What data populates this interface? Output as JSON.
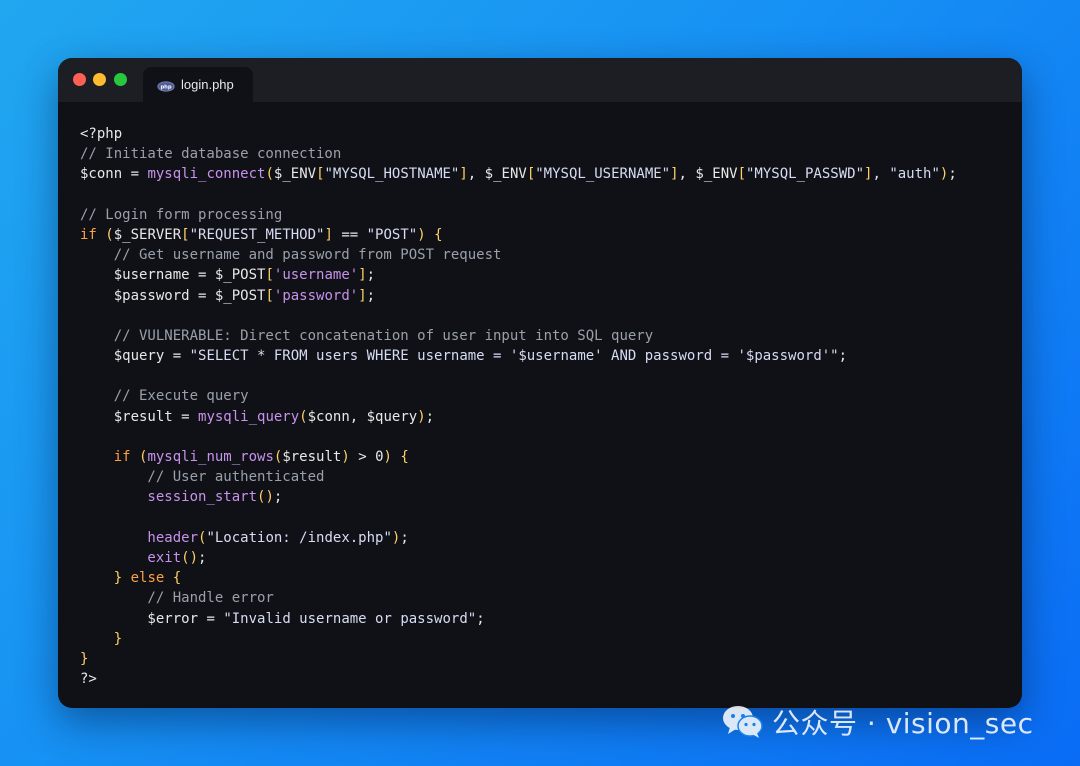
{
  "window": {
    "tab_label": "login.php",
    "tab_icon": "php-icon",
    "traffic_lights": {
      "close": "#fe5f57",
      "minimize": "#febc2e",
      "maximize": "#27c840"
    }
  },
  "colors": {
    "background_start": "#21a7f0",
    "background_end": "#0a6cf5",
    "editor_bg": "#0f1117",
    "keyword": "#ff9f43",
    "function": "#c792ea",
    "comment": "#9aa0aa",
    "bracket": "#ffd166"
  },
  "code_lines": [
    [
      {
        "t": "<?php",
        "c": "tag"
      }
    ],
    [
      {
        "t": "// Initiate database connection",
        "c": "cmt"
      }
    ],
    [
      {
        "t": "$conn",
        "c": "var"
      },
      {
        "t": " = ",
        "c": "pl"
      },
      {
        "t": "mysqli_connect",
        "c": "fn"
      },
      {
        "t": "(",
        "c": "br"
      },
      {
        "t": "$_ENV",
        "c": "var"
      },
      {
        "t": "[",
        "c": "br"
      },
      {
        "t": "\"MYSQL_HOSTNAME\"",
        "c": "str"
      },
      {
        "t": "]",
        "c": "br"
      },
      {
        "t": ", ",
        "c": "pl"
      },
      {
        "t": "$_ENV",
        "c": "var"
      },
      {
        "t": "[",
        "c": "br"
      },
      {
        "t": "\"MYSQL_USERNAME\"",
        "c": "str"
      },
      {
        "t": "]",
        "c": "br"
      },
      {
        "t": ", ",
        "c": "pl"
      },
      {
        "t": "$_ENV",
        "c": "var"
      },
      {
        "t": "[",
        "c": "br"
      },
      {
        "t": "\"MYSQL_PASSWD\"",
        "c": "str"
      },
      {
        "t": "]",
        "c": "br"
      },
      {
        "t": ", ",
        "c": "pl"
      },
      {
        "t": "\"auth\"",
        "c": "str"
      },
      {
        "t": ")",
        "c": "br"
      },
      {
        "t": ";",
        "c": "pl"
      }
    ],
    [],
    [
      {
        "t": "// Login form processing",
        "c": "cmt"
      }
    ],
    [
      {
        "t": "if",
        "c": "kw"
      },
      {
        "t": " ",
        "c": "pl"
      },
      {
        "t": "(",
        "c": "br"
      },
      {
        "t": "$_SERVER",
        "c": "var"
      },
      {
        "t": "[",
        "c": "br"
      },
      {
        "t": "\"REQUEST_METHOD\"",
        "c": "str"
      },
      {
        "t": "]",
        "c": "br"
      },
      {
        "t": " == ",
        "c": "pl"
      },
      {
        "t": "\"POST\"",
        "c": "str"
      },
      {
        "t": ")",
        "c": "br"
      },
      {
        "t": " ",
        "c": "pl"
      },
      {
        "t": "{",
        "c": "br"
      }
    ],
    [
      {
        "t": "    // Get username and password from POST request",
        "c": "cmt"
      }
    ],
    [
      {
        "t": "    $username",
        "c": "var"
      },
      {
        "t": " = ",
        "c": "pl"
      },
      {
        "t": "$_POST",
        "c": "var"
      },
      {
        "t": "[",
        "c": "br"
      },
      {
        "t": "'username'",
        "c": "fn"
      },
      {
        "t": "]",
        "c": "br"
      },
      {
        "t": ";",
        "c": "pl"
      }
    ],
    [
      {
        "t": "    $password",
        "c": "var"
      },
      {
        "t": " = ",
        "c": "pl"
      },
      {
        "t": "$_POST",
        "c": "var"
      },
      {
        "t": "[",
        "c": "br"
      },
      {
        "t": "'password'",
        "c": "fn"
      },
      {
        "t": "]",
        "c": "br"
      },
      {
        "t": ";",
        "c": "pl"
      }
    ],
    [],
    [
      {
        "t": "    // VULNERABLE: Direct concatenation of user input into SQL query",
        "c": "cmt"
      }
    ],
    [
      {
        "t": "    $query",
        "c": "var"
      },
      {
        "t": " = ",
        "c": "pl"
      },
      {
        "t": "\"SELECT * FROM users WHERE username = '$username' AND password = '$password'\"",
        "c": "str"
      },
      {
        "t": ";",
        "c": "pl"
      }
    ],
    [],
    [
      {
        "t": "    // Execute query",
        "c": "cmt"
      }
    ],
    [
      {
        "t": "    $result",
        "c": "var"
      },
      {
        "t": " = ",
        "c": "pl"
      },
      {
        "t": "mysqli_query",
        "c": "fn"
      },
      {
        "t": "(",
        "c": "br"
      },
      {
        "t": "$conn",
        "c": "var"
      },
      {
        "t": ", ",
        "c": "pl"
      },
      {
        "t": "$query",
        "c": "var"
      },
      {
        "t": ")",
        "c": "br"
      },
      {
        "t": ";",
        "c": "pl"
      }
    ],
    [],
    [
      {
        "t": "    if",
        "c": "kw"
      },
      {
        "t": " ",
        "c": "pl"
      },
      {
        "t": "(",
        "c": "br"
      },
      {
        "t": "mysqli_num_rows",
        "c": "fn"
      },
      {
        "t": "(",
        "c": "br"
      },
      {
        "t": "$result",
        "c": "var"
      },
      {
        "t": ")",
        "c": "br"
      },
      {
        "t": " > 0",
        "c": "pl"
      },
      {
        "t": ")",
        "c": "br"
      },
      {
        "t": " ",
        "c": "pl"
      },
      {
        "t": "{",
        "c": "br"
      }
    ],
    [
      {
        "t": "        // User authenticated",
        "c": "cmt"
      }
    ],
    [
      {
        "t": "        session_start",
        "c": "fn"
      },
      {
        "t": "()",
        "c": "br"
      },
      {
        "t": ";",
        "c": "pl"
      }
    ],
    [],
    [
      {
        "t": "        header",
        "c": "fn"
      },
      {
        "t": "(",
        "c": "br"
      },
      {
        "t": "\"Location: /index.php\"",
        "c": "str"
      },
      {
        "t": ")",
        "c": "br"
      },
      {
        "t": ";",
        "c": "pl"
      }
    ],
    [
      {
        "t": "        exit",
        "c": "fn"
      },
      {
        "t": "()",
        "c": "br"
      },
      {
        "t": ";",
        "c": "pl"
      }
    ],
    [
      {
        "t": "    ",
        "c": "pl"
      },
      {
        "t": "}",
        "c": "br"
      },
      {
        "t": " ",
        "c": "pl"
      },
      {
        "t": "else",
        "c": "kw"
      },
      {
        "t": " ",
        "c": "pl"
      },
      {
        "t": "{",
        "c": "br"
      }
    ],
    [
      {
        "t": "        // Handle error",
        "c": "cmt"
      }
    ],
    [
      {
        "t": "        $error",
        "c": "var"
      },
      {
        "t": " = ",
        "c": "pl"
      },
      {
        "t": "\"Invalid username or password\"",
        "c": "str"
      },
      {
        "t": ";",
        "c": "pl"
      }
    ],
    [
      {
        "t": "    ",
        "c": "pl"
      },
      {
        "t": "}",
        "c": "br"
      }
    ],
    [
      {
        "t": "}",
        "c": "br"
      }
    ],
    [
      {
        "t": "?>",
        "c": "tag"
      }
    ]
  ],
  "watermark": {
    "icon": "wechat-icon",
    "text": "公众号 · vision_sec"
  }
}
